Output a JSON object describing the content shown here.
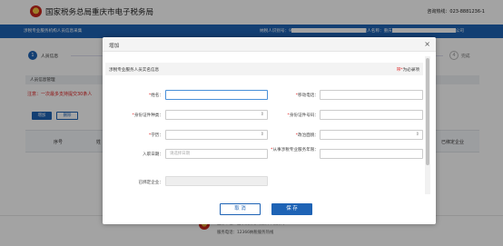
{
  "site": {
    "title": "国家税务总局重庆市电子税务局",
    "hotline": "咨询热线：023-8881236-1"
  },
  "nav": {
    "left": "涉税专业服务机构人员信息采集",
    "mid_label": "纳税人识别号：9",
    "right_label": "纳税人名称：重庆",
    "right_suffix": "公司"
  },
  "steps": [
    {
      "num": "1",
      "label": "人员信息"
    },
    {
      "num": "4",
      "label": "完成"
    }
  ],
  "section": {
    "title": "人员信息管理"
  },
  "notice": "注意：一次最多支持提交30条人",
  "toolbar": {
    "add": "增加",
    "delete": "删除"
  },
  "table": {
    "headers": [
      "序号",
      "姓",
      "已绑定企业"
    ]
  },
  "footer": {
    "line1": "主办单位：国家税务总局重庆市税务局",
    "line2": "服务电话：12366纳税服务热线"
  },
  "modal": {
    "title": "增加",
    "close": "×",
    "form_title": "涉税专业服务人员实名信息",
    "required_note_star": "带*",
    "required_note_rest": "为必录项",
    "fields": {
      "name": "姓名：",
      "mobile": "移动电话：",
      "id_type": "身份证件种类：",
      "id_number": "身份证件号码：",
      "education": "学历：",
      "political": "政治面貌：",
      "join_date": "入职日期：",
      "join_date_placeholder": "请选择日期",
      "years": "从事涉税专业服务年限：",
      "bound": "已绑定企业："
    },
    "buttons": {
      "cancel": "取 消",
      "save": "保 存"
    }
  }
}
